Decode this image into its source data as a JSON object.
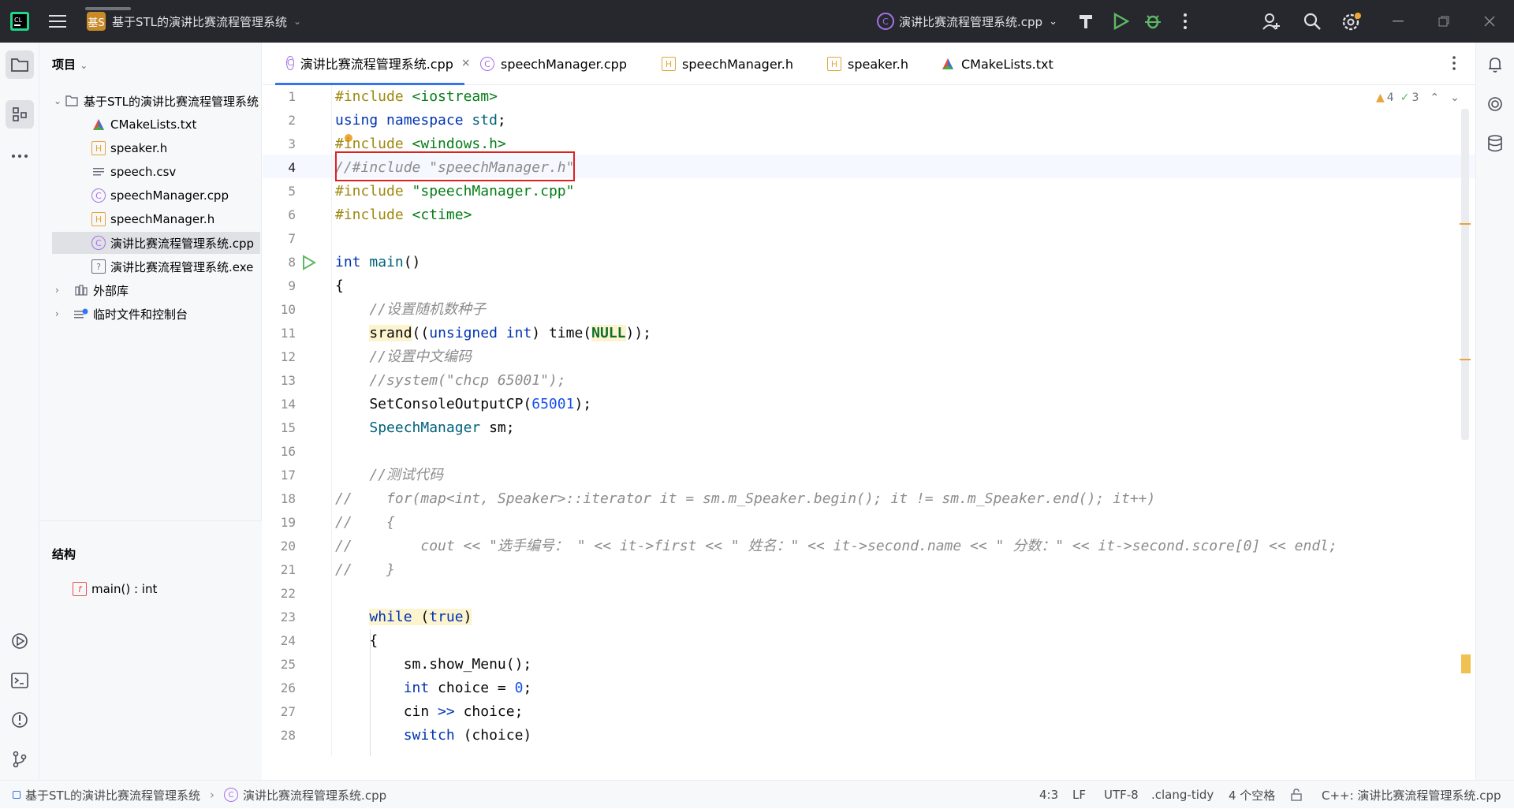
{
  "titlebar": {
    "project_badge": "基S",
    "project_name": "基于STL的演讲比赛流程管理系统",
    "run_config": "演讲比赛流程管理系统.cpp"
  },
  "project_panel": {
    "title": "项目",
    "root": "基于STL的演讲比赛流程管理系统",
    "files": [
      {
        "name": "CMakeLists.txt",
        "icon": "cmake-icon"
      },
      {
        "name": "speaker.h",
        "icon": "header-icon"
      },
      {
        "name": "speech.csv",
        "icon": "csv-icon"
      },
      {
        "name": "speechManager.cpp",
        "icon": "cpp-icon"
      },
      {
        "name": "speechManager.h",
        "icon": "header-icon"
      },
      {
        "name": "演讲比赛流程管理系统.cpp",
        "icon": "cpp-icon"
      },
      {
        "name": "演讲比赛流程管理系统.exe",
        "icon": "unknown-file-icon"
      }
    ],
    "external": "外部库",
    "scratches": "临时文件和控制台"
  },
  "structure": {
    "title": "结构",
    "item": "main() : int"
  },
  "tabs": [
    {
      "label": "演讲比赛流程管理系统.cpp",
      "active": true
    },
    {
      "label": "speechManager.cpp"
    },
    {
      "label": "speechManager.h"
    },
    {
      "label": "speaker.h"
    },
    {
      "label": "CMakeLists.txt"
    }
  ],
  "inspections": {
    "warnings": "4",
    "weak": "3"
  },
  "code_lines": [
    {
      "n": "1"
    },
    {
      "n": "2"
    },
    {
      "n": "3"
    },
    {
      "n": "4"
    },
    {
      "n": "5"
    },
    {
      "n": "6"
    },
    {
      "n": "7"
    },
    {
      "n": "8"
    },
    {
      "n": "9"
    },
    {
      "n": "10"
    },
    {
      "n": "11"
    },
    {
      "n": "12"
    },
    {
      "n": "13"
    },
    {
      "n": "14"
    },
    {
      "n": "15"
    },
    {
      "n": "16"
    },
    {
      "n": "17"
    },
    {
      "n": "18"
    },
    {
      "n": "19"
    },
    {
      "n": "20"
    },
    {
      "n": "21"
    },
    {
      "n": "22"
    },
    {
      "n": "23"
    },
    {
      "n": "24"
    },
    {
      "n": "25"
    },
    {
      "n": "26"
    },
    {
      "n": "27"
    },
    {
      "n": "28"
    }
  ],
  "code": {
    "l1a": "#include ",
    "l1b": "<iostream>",
    "l2a": "using ",
    "l2b": "namespace ",
    "l2c": "std",
    "l2d": ";",
    "l3a": "#include ",
    "l3b": "<windows.h>",
    "l4": "//#include \"speechManager.h\"",
    "l5a": "#include ",
    "l5b": "\"speechManager.cpp\"",
    "l6a": "#include ",
    "l6b": "<ctime>",
    "l8a": "int ",
    "l8b": "main",
    "l8c": "()",
    "l9": "{",
    "l10": "    //设置随机数种子",
    "l11a": "    ",
    "l11b": "srand",
    "l11c": "((",
    "l11d": "unsigned int",
    "l11e": ") time(",
    "l11f": "NULL",
    "l11g": "));",
    "l12": "    //设置中文编码",
    "l13": "    //system(\"chcp 65001\");",
    "l14a": "    SetConsoleOutputCP(",
    "l14b": "65001",
    "l14c": ");",
    "l15a": "    ",
    "l15b": "SpeechManager",
    "l15c": " sm;",
    "l17": "    //测试代码",
    "l18": "//    for(map<int, Speaker>::iterator it = sm.m_Speaker.begin(); it != sm.m_Speaker.end(); it++)",
    "l19": "//    {",
    "l20": "//        cout << \"选手编号： \" << it->first << \" 姓名：\" << it->second.name << \" 分数：\" << it->second.score[0] << endl;",
    "l21": "//    }",
    "l23a": "    ",
    "l23b": "while",
    "l23c": " (",
    "l23d": "true",
    "l23e": ")",
    "l24": "    {",
    "l25": "        sm.show_Menu();",
    "l26a": "        ",
    "l26b": "int",
    "l26c": " choice = ",
    "l26d": "0",
    "l26e": ";",
    "l27a": "        cin ",
    "l27b": ">>",
    "l27c": " choice;",
    "l28a": "        ",
    "l28b": "switch",
    "l28c": " (choice)"
  },
  "status": {
    "crumb_project": "基于STL的演讲比赛流程管理系统",
    "crumb_file": "演讲比赛流程管理系统.cpp",
    "position": "4:3",
    "line_sep": "LF",
    "encoding": "UTF-8",
    "tidy": ".clang-tidy",
    "indent": "4 个空格",
    "language": "C++: 演讲比赛流程管理系统.cpp"
  },
  "colors": {
    "accent": "#3574f0",
    "highlight_box": "#e0201e",
    "warning": "#e5a53a"
  }
}
